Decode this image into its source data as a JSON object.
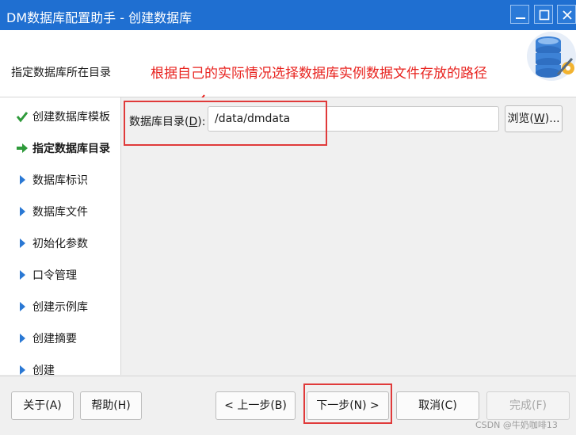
{
  "window": {
    "title": "DM数据库配置助手 - 创建数据库",
    "controls": [
      "minimize",
      "maximize",
      "close"
    ]
  },
  "header": {
    "step_title": "指定数据库所在目录",
    "annotation": "根据自己的实际情况选择数据库实例数据文件存放的路径",
    "icon": "database-settings-icon"
  },
  "sidebar": {
    "steps": [
      {
        "label": "创建数据库模板",
        "state": "done"
      },
      {
        "label": "指定数据库目录",
        "state": "current"
      },
      {
        "label": "数据库标识",
        "state": "pending"
      },
      {
        "label": "数据库文件",
        "state": "pending"
      },
      {
        "label": "初始化参数",
        "state": "pending"
      },
      {
        "label": "口令管理",
        "state": "pending"
      },
      {
        "label": "创建示例库",
        "state": "pending"
      },
      {
        "label": "创建摘要",
        "state": "pending"
      },
      {
        "label": "创建",
        "state": "pending"
      }
    ]
  },
  "form": {
    "dir_label_pre": "数据库目录(",
    "dir_label_key": "D",
    "dir_label_post": "):",
    "dir_value": "/data/dmdata",
    "browse_pre": "浏览(",
    "browse_key": "W",
    "browse_post": ")..."
  },
  "buttons": {
    "about": "关于(A)",
    "help": "帮助(H)",
    "prev": "< 上一步(B)",
    "next": "下一步(N) >",
    "cancel": "取消(C)",
    "finish": "完成(F)"
  },
  "watermark": "CSDN @牛奶咖啡13",
  "colors": {
    "titlebar": "#1f6fd1",
    "annotation_red": "#e8231f",
    "check_green": "#2e9a3a",
    "arrow_blue": "#2a78d4"
  }
}
